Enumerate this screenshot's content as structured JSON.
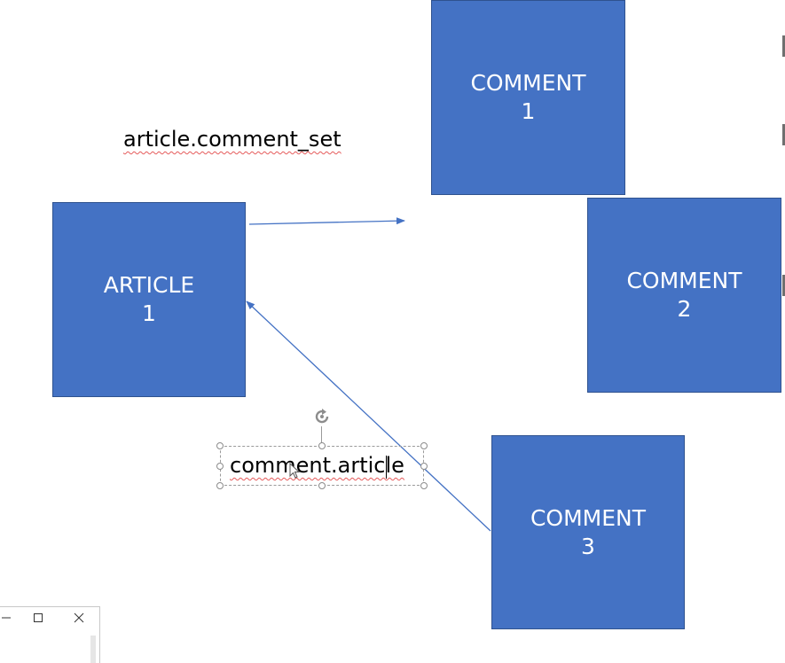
{
  "slide": {
    "boxes": {
      "comment_1": {
        "line1": "COMMENT",
        "line2": "1"
      },
      "article_1": {
        "line1": "ARTICLE",
        "line2": "1"
      },
      "comment_2": {
        "line1": "COMMENT",
        "line2": "2"
      },
      "comment_3": {
        "line1": "COMMENT",
        "line2": "3"
      }
    },
    "labels": {
      "comment_set": "article.comment_set",
      "comment_article": "comment.article"
    }
  },
  "colors": {
    "box_fill": "#4472c4",
    "box_border": "#2f528f",
    "arrow": "#4472c4",
    "spellcheck_underline": "#e55b5b"
  },
  "icons": {
    "rotate": "rotate-handle-icon",
    "cursor": "arrow-cursor-icon",
    "minimize": "minimize-icon",
    "maximize": "maximize-icon",
    "close": "close-icon"
  }
}
